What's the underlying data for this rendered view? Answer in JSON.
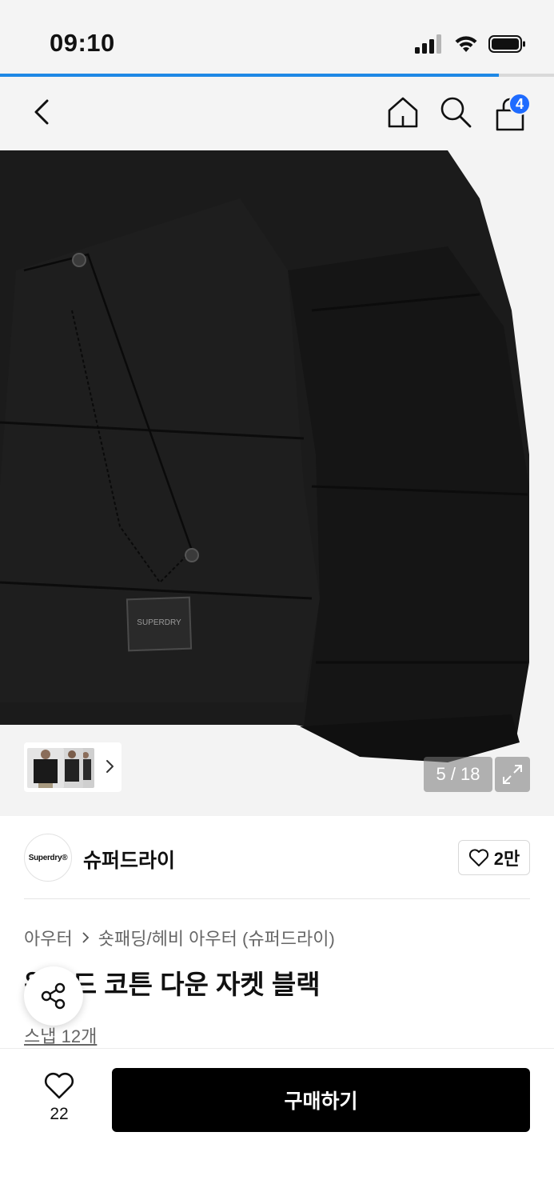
{
  "status_bar": {
    "time": "09:10"
  },
  "loading_progress": 0.9,
  "nav": {
    "cart_badge": "4"
  },
  "gallery": {
    "counter": "5 / 18",
    "brand_label_on_patch": "SUPERDRY"
  },
  "brand": {
    "logo_text": "Superdry®",
    "name": "슈퍼드라이",
    "likes": "2만"
  },
  "breadcrumb": {
    "category": "아우터",
    "subcategory": "숏패딩/헤비 아우터 (슈퍼드라이)"
  },
  "product": {
    "title": "왁스드 코튼 다운 자켓 블랙",
    "title_visible": "  턴 다운 자켓 블랙",
    "snap_link": "스냅 12개"
  },
  "bottom": {
    "like_count": "22",
    "buy_label": "구매하기"
  },
  "colors": {
    "accent": "#1e88e5",
    "badge": "#1e6bff",
    "buy_bg": "#000000"
  },
  "icons": [
    "back-icon",
    "home-icon",
    "search-icon",
    "cart-icon",
    "chevron-right-icon",
    "expand-icon",
    "heart-icon",
    "share-icon"
  ]
}
